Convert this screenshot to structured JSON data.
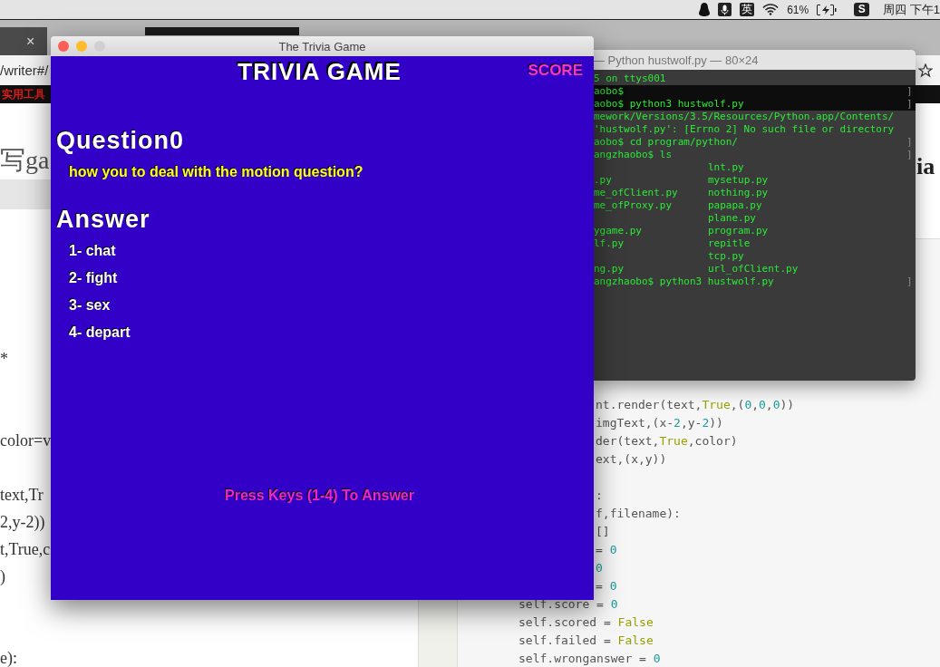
{
  "menu_bar": {
    "input_method": "英",
    "battery": "61%",
    "app_badge": "S",
    "clock": "周四 下午1"
  },
  "browser": {
    "tab_close": "×",
    "address": "/writer#/",
    "bookmark": "实用工具",
    "editor_title": "写ga",
    "preview_title_tail": "ia",
    "editor_lines": [
      "*",
      "color=v",
      "text,Tr",
      "2,y-2))",
      "t,True,c",
      ")",
      "e):"
    ],
    "code_lines": [
      {
        "tokens": [
          {
            "text": "nt.render(text,",
            "kind": "plain"
          },
          {
            "text": "True",
            "kind": "keyword"
          },
          {
            "text": ",(",
            "kind": "plain"
          },
          {
            "text": "0",
            "kind": "number"
          },
          {
            "text": ",",
            "kind": "plain"
          },
          {
            "text": "0",
            "kind": "number"
          },
          {
            "text": ",",
            "kind": "plain"
          },
          {
            "text": "0",
            "kind": "number"
          },
          {
            "text": "))",
            "kind": "plain"
          }
        ]
      },
      {
        "tokens": [
          {
            "text": "imgText,(x-",
            "kind": "plain"
          },
          {
            "text": "2",
            "kind": "number"
          },
          {
            "text": ",y-",
            "kind": "plain"
          },
          {
            "text": "2",
            "kind": "number"
          },
          {
            "text": "))",
            "kind": "plain"
          }
        ]
      },
      {
        "tokens": [
          {
            "text": "der(text,",
            "kind": "plain"
          },
          {
            "text": "True",
            "kind": "keyword"
          },
          {
            "text": ",color)",
            "kind": "plain"
          }
        ]
      },
      {
        "tokens": [
          {
            "text": "ext,(x,y))",
            "kind": "plain"
          }
        ]
      },
      {
        "tokens": [
          {
            "text": ":",
            "kind": "plain"
          }
        ]
      },
      {
        "tokens": [
          {
            "text": "f,filename):",
            "kind": "plain"
          }
        ]
      },
      {
        "tokens": [
          {
            "text": "[]",
            "kind": "plain"
          }
        ]
      },
      {
        "tokens": [
          {
            "text": "= ",
            "kind": "plain"
          },
          {
            "text": "0",
            "kind": "number"
          }
        ]
      },
      {
        "tokens": [
          {
            "text": "0",
            "kind": "number"
          }
        ]
      },
      {
        "tokens": [
          {
            "text": "= ",
            "kind": "plain"
          },
          {
            "text": "0",
            "kind": "number"
          }
        ]
      },
      {
        "tokens": [
          {
            "text": "self.score = ",
            "kind": "plain"
          },
          {
            "text": "0",
            "kind": "number"
          }
        ]
      },
      {
        "tokens": [
          {
            "text": "self.scored = ",
            "kind": "plain"
          },
          {
            "text": "False",
            "kind": "keyword"
          }
        ]
      },
      {
        "tokens": [
          {
            "text": "self.failed = ",
            "kind": "plain"
          },
          {
            "text": "False",
            "kind": "keyword"
          }
        ]
      },
      {
        "tokens": [
          {
            "text": "self.wronganswer = ",
            "kind": "plain"
          },
          {
            "text": "0",
            "kind": "number"
          }
        ]
      }
    ]
  },
  "terminal": {
    "title": "— Python hustwolf.py — 80×24",
    "lines": [
      {
        "text": "5 on ttys001",
        "highlighted": false
      },
      {
        "text": "aobo$",
        "end": "]",
        "highlighted": true
      },
      {
        "text": "aobo$ python3 hustwolf.py",
        "end": "]",
        "highlighted": true
      },
      {
        "text": "mework/Versions/3.5/Resources/Python.app/Contents/",
        "highlighted": false
      },
      {
        "text": "'hustwolf.py': [Errno 2] No such file or directory",
        "highlighted": false
      },
      {
        "text": "aobo$ cd program/python/",
        "end": "]",
        "highlighted": false
      },
      {
        "text": "angzhaobo$ ls",
        "end": "]",
        "highlighted": false
      },
      {
        "column_2": "lnt.py",
        "highlighted": false
      },
      {
        "text": ".py",
        "column_2": "mysetup.py",
        "highlighted": false
      },
      {
        "text": "me_ofClient.py",
        "column_2": "nothing.py",
        "highlighted": false
      },
      {
        "text": "me_ofProxy.py",
        "column_2": "papapa.py",
        "highlighted": false
      },
      {
        "column_2": "plane.py",
        "highlighted": false
      },
      {
        "text": "ygame.py",
        "column_2": "program.py",
        "highlighted": false
      },
      {
        "text": "lf.py",
        "column_2": "repitle",
        "highlighted": false
      },
      {
        "column_2": "tcp.py",
        "highlighted": false
      },
      {
        "text": "ng.py",
        "column_2": "url_ofClient.py",
        "highlighted": false
      },
      {
        "text": "angzhaobo$ python3 hustwolf.py",
        "end": "]",
        "highlighted": false
      }
    ]
  },
  "game": {
    "title": "The Trivia Game",
    "heading": "TRIVIA GAME",
    "score_label": "SCORE",
    "question_label": "Question0",
    "question": "how you to deal with the motion question?",
    "answer_label": "Answer",
    "answers": [
      "1- chat",
      "2- fight",
      "3- sex",
      "4- depart"
    ],
    "prompt": "Press Keys (1-4) To Answer"
  }
}
